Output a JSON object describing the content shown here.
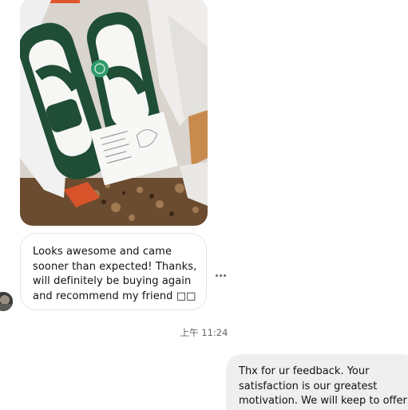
{
  "photo_message": {
    "icon": "image-icon"
  },
  "incoming_message": {
    "lines": [
      "Looks awesome and came",
      "sooner than expected! Thanks,",
      "will definitely be buying again",
      "and recommend my friend □□"
    ]
  },
  "more_options": {
    "icon": "more-horizontal-icon"
  },
  "timestamp": "上午 11:24",
  "outgoing_message": {
    "lines": [
      "Thx for ur feedback. Your",
      "satisfaction is our greatest",
      "motivation. We will keep to offer"
    ]
  }
}
